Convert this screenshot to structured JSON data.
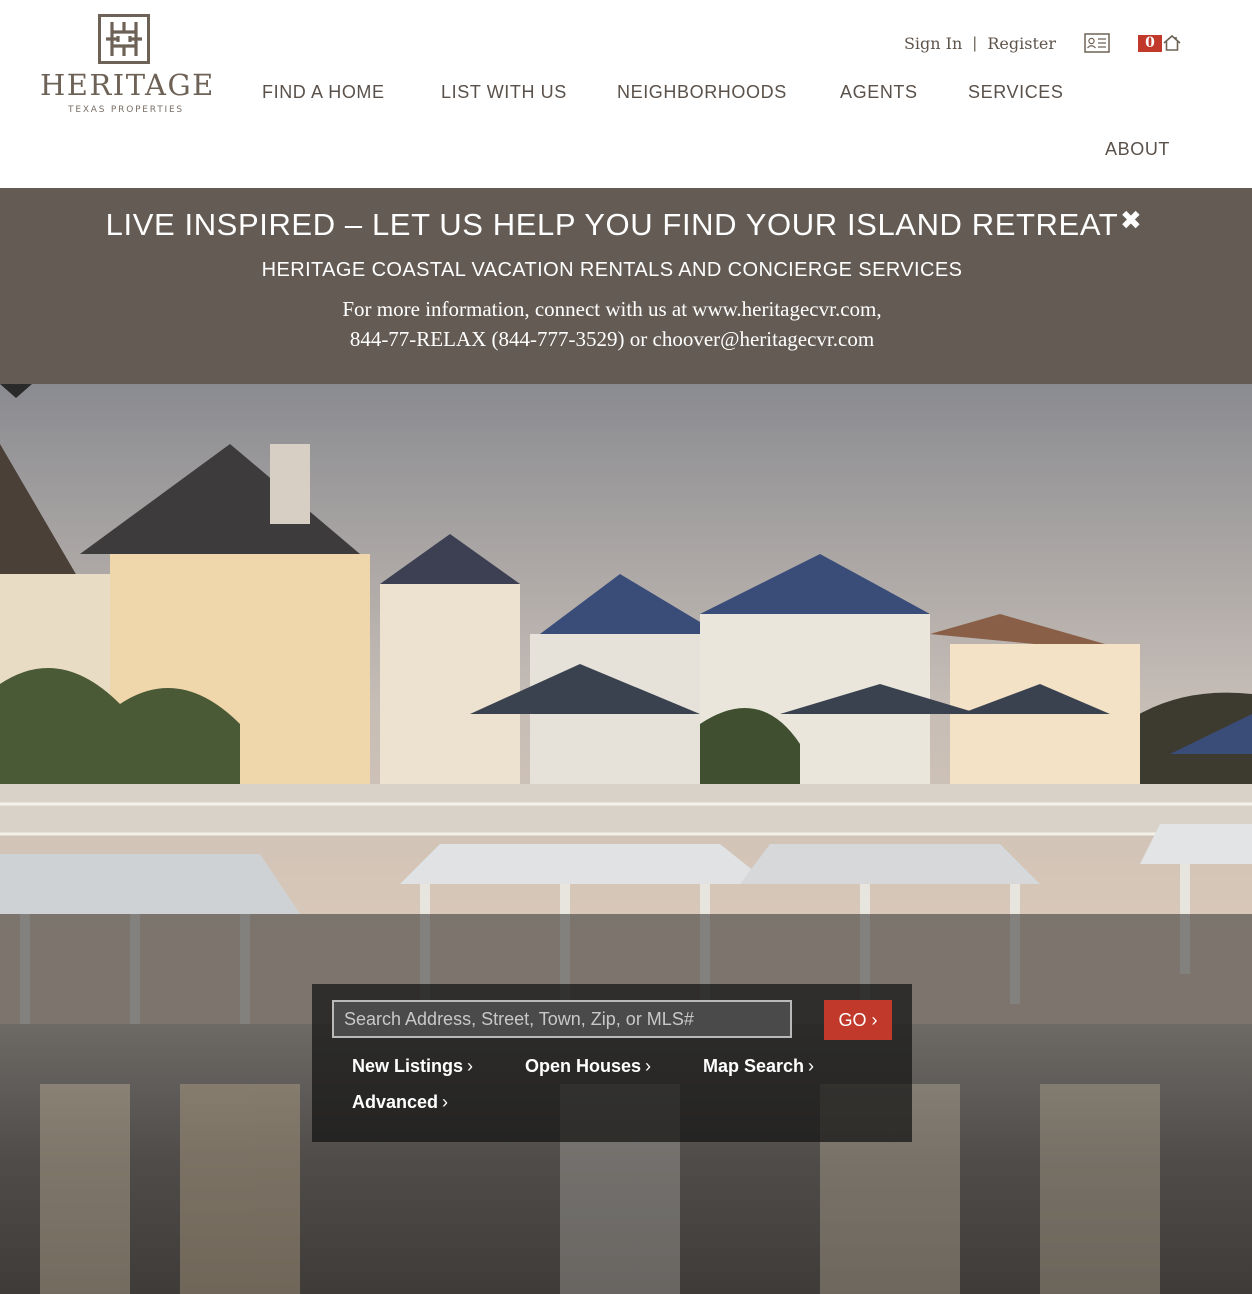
{
  "brand": {
    "name": "HERITAGE",
    "tagline": "TEXAS PROPERTIES",
    "logo_icon": "heritage-maze-logo-icon",
    "color": "#6e6257"
  },
  "utility": {
    "sign_in": "Sign In",
    "separator": "|",
    "register": "Register",
    "contact_card_icon": "contact-card-icon",
    "saved_count": "0",
    "saved_homes_icon": "house-icon"
  },
  "nav": {
    "items": [
      "FIND A HOME",
      "LIST WITH US",
      "NEIGHBORHOODS",
      "AGENTS",
      "SERVICES",
      "ABOUT"
    ]
  },
  "banner": {
    "title": "LIVE INSPIRED – LET US HELP YOU FIND YOUR ISLAND RETREAT",
    "close_icon": "close-icon",
    "subtitle": "HERITAGE COASTAL VACATION RENTALS AND CONCIERGE SERVICES",
    "info_line1": "For more information, connect with us at www.heritagecvr.com,",
    "info_line2": "844-77-RELAX (844-777-3529) or choover@heritagecvr.com",
    "background": "#645c54"
  },
  "search": {
    "placeholder": "Search Address, Street, Town, Zip, or MLS#",
    "go_label": "GO",
    "go_color": "#c0392b",
    "links": [
      "New Listings",
      "Open Houses",
      "Map Search",
      "Advanced"
    ],
    "chevron": "›",
    "scroll_icon": "down-arrow-icon"
  },
  "hero": {
    "image": "waterfront-homes-photo"
  }
}
